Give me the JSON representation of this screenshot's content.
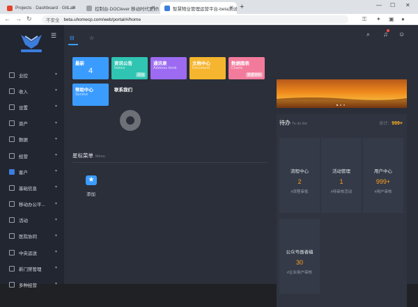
{
  "browser": {
    "tabs": [
      {
        "title": "Projects · Dashboard · GitLab",
        "color": "#e24329"
      },
      {
        "title": "控制台-DOClever 移动时代更好的",
        "color": "#5f6368"
      },
      {
        "title": "智慧物业管理运营平台-beta测试",
        "color": "#3b7ddd"
      }
    ],
    "url": "beta.uhomecp.com/web/portal/#/home",
    "security": "不安全"
  },
  "sidebar": {
    "items": [
      {
        "label": "业控"
      },
      {
        "label": "收入"
      },
      {
        "label": "设置"
      },
      {
        "label": "资产"
      },
      {
        "label": "数据"
      },
      {
        "label": "经营"
      },
      {
        "label": "客户"
      },
      {
        "label": "基础信息"
      },
      {
        "label": "移动办公平..."
      },
      {
        "label": "活动"
      },
      {
        "label": "医院协同"
      },
      {
        "label": "中央运送"
      },
      {
        "label": "新门禁管理"
      },
      {
        "label": "多种经营"
      }
    ]
  },
  "tiles": [
    {
      "title": "最新",
      "subtitle": "",
      "value": "4",
      "pill": "",
      "color": "#3b9cff"
    },
    {
      "title": "资讯公告",
      "subtitle": "Notice",
      "value": "",
      "pill": "添加",
      "color": "#2fc5b2"
    },
    {
      "title": "通讯录",
      "subtitle": "Address book",
      "value": "",
      "pill": "",
      "color": "#9c6bf2"
    },
    {
      "title": "文档中心",
      "subtitle": "Document",
      "value": "",
      "pill": "",
      "color": "#f5b52e"
    },
    {
      "title": "数据图表",
      "subtitle": "Charts",
      "value": "",
      "pill": "数据资料",
      "color": "#f27b9c"
    },
    {
      "title": "帮助中心",
      "subtitle": "Service",
      "value": "",
      "pill": "",
      "color": "#3b9cff"
    },
    {
      "title": "联系我们",
      "subtitle": "",
      "value": "",
      "pill": "",
      "color": "#2b2f3a"
    }
  ],
  "shortcut": {
    "title": "星标菜单",
    "subtitle": "Menu",
    "add_label": "添加"
  },
  "todo": {
    "title": "待办",
    "subtitle": "To do list",
    "total_label": "总计：",
    "total_value": "999+",
    "cells": [
      {
        "label": "流程中心",
        "value": "2",
        "sub": "#流程审批"
      },
      {
        "label": "活动管理",
        "value": "1",
        "sub": "#待审核活动"
      },
      {
        "label": "用户中心",
        "value": "999+",
        "sub": "#用户审核"
      },
      {
        "label": "公众号画者编",
        "value": "30",
        "sub": "#企业用户审核"
      }
    ]
  }
}
